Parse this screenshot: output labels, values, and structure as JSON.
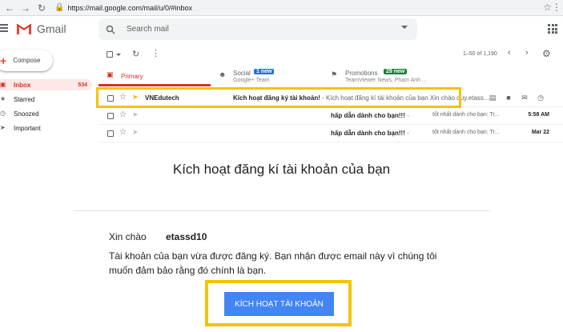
{
  "browser": {
    "url": "https://mail.google.com/mail/u/0/#inbox",
    "back_icon": "arrow-left-icon",
    "forward_icon": "arrow-right-icon",
    "reload_icon": "reload-icon"
  },
  "header": {
    "app_name": "Gmail",
    "search_placeholder": "Search mail"
  },
  "sidebar": {
    "compose_label": "Compose",
    "items": [
      {
        "label": "Inbox",
        "count": "534",
        "icon": "inbox-icon"
      },
      {
        "label": "Starred",
        "icon": "star-icon"
      },
      {
        "label": "Snoozed",
        "icon": "clock-icon"
      },
      {
        "label": "Important",
        "icon": "important-icon"
      }
    ]
  },
  "toolbar": {
    "page_info": "1–50 of 1,190"
  },
  "tabs": [
    {
      "name": "Primary",
      "badge": "",
      "sub": ""
    },
    {
      "name": "Social",
      "badge": "1 new",
      "sub": "Google+ Team"
    },
    {
      "name": "Promotions",
      "badge": "29 new",
      "sub": "TeamViewer News, Pham Anh ..."
    }
  ],
  "emails": [
    {
      "sender": "VNEdutech",
      "subject": "Kích hoạt đăng ký tài khoản!",
      "snippet": " - Kích hoạt đăng kí tài khoản của bạn Xin chào quy.etass...",
      "snippet2": "",
      "date": ""
    },
    {
      "sender": "",
      "subject": "hấp dẫn dành cho bạn!!!",
      "snippet": " -",
      "snippet2": "tốt nhất dành cho bạn: Tr...",
      "date": "5:58 AM"
    },
    {
      "sender": "",
      "subject": "hấp dẫn dành cho bạn!!!",
      "snippet": " -",
      "snippet2": "tốt nhất dành cho bạn: Tr...",
      "date": "Mar 22"
    }
  ],
  "preview": {
    "title": "Kích hoạt đăng kí tài khoản của bạn",
    "greeting": "Xin chào",
    "username": "etassd10",
    "body": "Tài khoản của bạn vừa được đăng ký. Bạn nhận được email này vì chúng tôi muốn đảm bảo rằng đó chính là bạn.",
    "cta_label": "KÍCH HOẠT TÀI KHOẢN"
  },
  "colors": {
    "accent_red": "#d93025",
    "highlight_yellow": "#f6c200",
    "cta_blue": "#4285f4",
    "social_badge": "#1a73e8",
    "promo_badge": "#188038"
  }
}
